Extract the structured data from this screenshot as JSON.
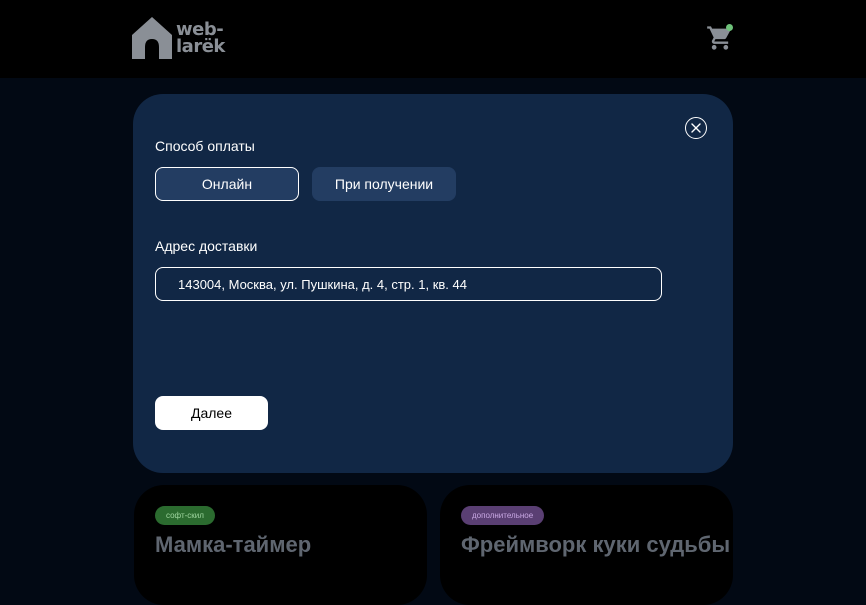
{
  "header": {
    "logo": {
      "line1": "web-",
      "line2": "larёk",
      "icon": "house-icon"
    },
    "cart": {
      "icon": "cart-icon",
      "badge": ""
    }
  },
  "modal": {
    "close_icon": "close-icon",
    "payment_label": "Способ оплаты",
    "payment_options": [
      "Онлайн",
      "При получении"
    ],
    "selected_payment": "Онлайн",
    "address_label": "Адрес доставки",
    "address_value": "143004, Москва, ул. Пушкина, д. 4, стр. 1, кв. 44",
    "next_label": "Далее"
  },
  "cards": [
    {
      "category": "софт-скил",
      "title": "Мамка-таймер"
    },
    {
      "category": "дополнительное",
      "title": "Фреймворк куки судьбы"
    }
  ],
  "colors": {
    "background": "#020914",
    "modal": "#112745",
    "button": "#233d62",
    "tag_soft": "#2b6b2f",
    "tag_extra": "#5a3f73"
  }
}
